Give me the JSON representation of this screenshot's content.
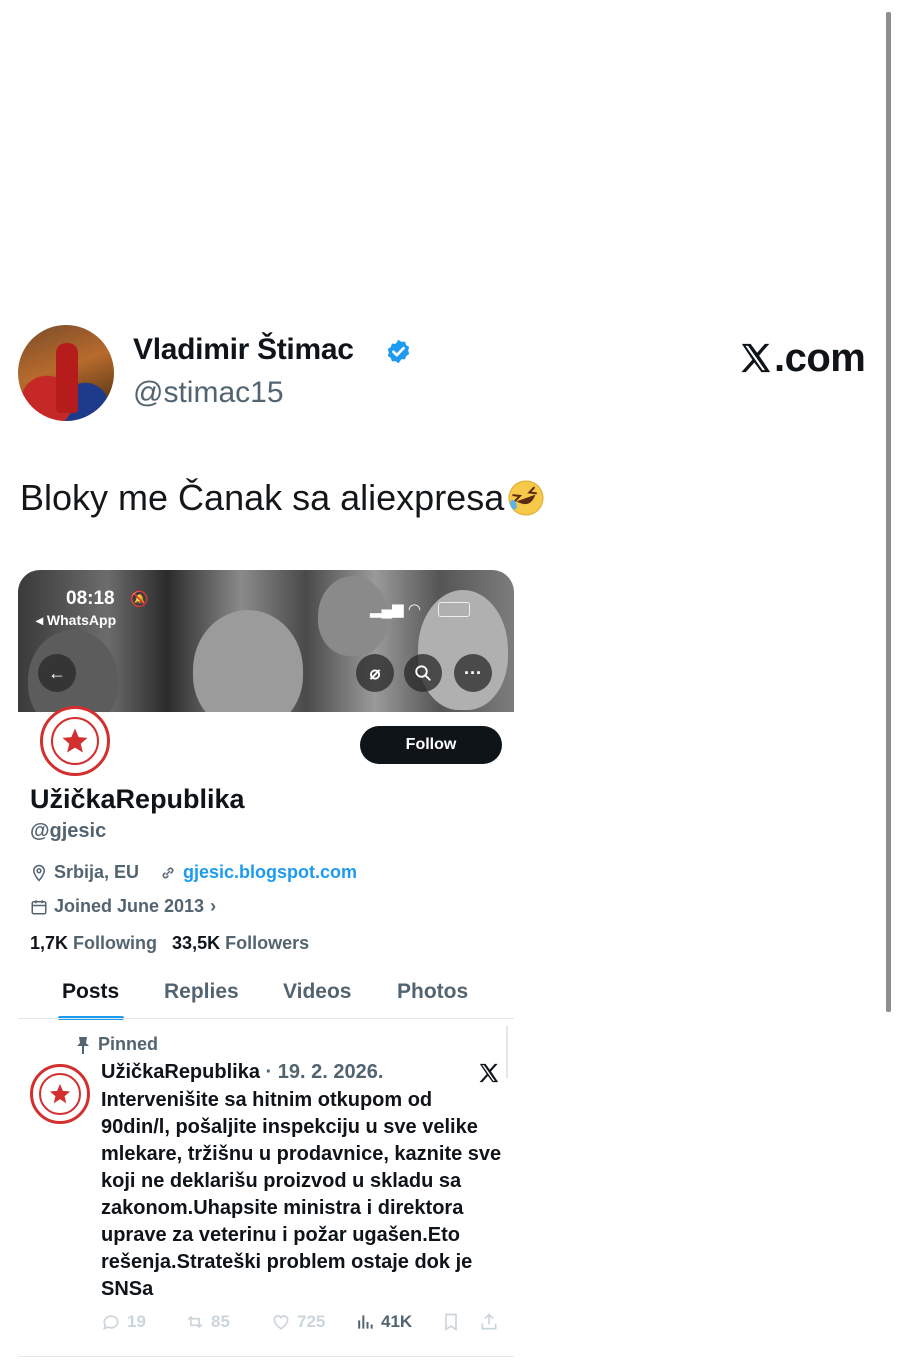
{
  "tweet": {
    "author_name": "Vladimir Štimac",
    "author_handle": "@stimac15",
    "site_label": ".com",
    "text": "Bloky me Čanak sa aliexpresa",
    "emoji": "rolling-on-floor-laughing"
  },
  "screenshot": {
    "status_bar": {
      "time": "08:18",
      "back_app": "◂ WhatsApp"
    },
    "profile": {
      "name": "UžičkaRepublika",
      "handle": "@gjesic",
      "location": "Srbija, EU",
      "website": "gjesic.blogspot.com",
      "joined": "Joined June 2013",
      "following_count": "1,7K",
      "following_label": "Following",
      "followers_count": "33,5K",
      "followers_label": "Followers",
      "follow_button": "Follow"
    },
    "tabs": [
      "Posts",
      "Replies",
      "Videos",
      "Photos"
    ],
    "active_tab": "Posts",
    "pinned_post": {
      "pinned_label": "Pinned",
      "author": "UžičkaRepublika",
      "date": " · 19. 2. 2026.",
      "text": "Intervenišite sa hitnim otkupom od 90din/l, pošaljite inspekciju u sve velike mlekare, tržišnu u prodavnice, kaznite sve koji ne deklarišu proizvod u skladu sa zakonom.Uhapsite ministra i direktora uprave za veterinu i požar ugašen.Eto rešenja.Strateški problem ostaje dok je SNSa",
      "replies": "19",
      "reposts": "85",
      "likes": "725",
      "views": "41K"
    }
  },
  "colors": {
    "accent": "#1d9bf0",
    "seal_red": "#d32f2f",
    "text_dark": "#0f1419",
    "text_muted": "#536471"
  }
}
